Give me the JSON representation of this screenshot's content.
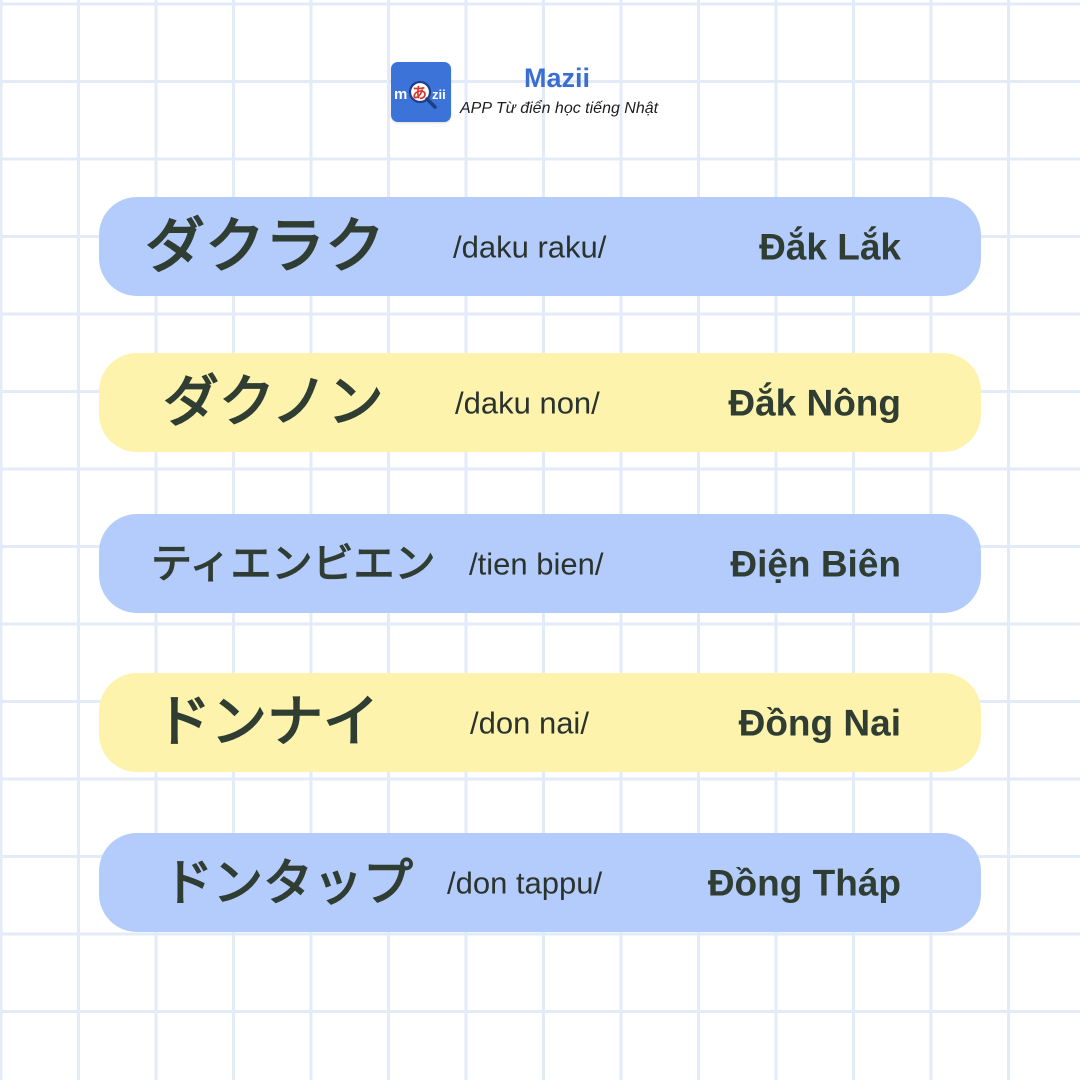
{
  "header": {
    "logo_text": "mあzii",
    "brand_name": "Mazii",
    "tagline": "APP Từ điển học tiếng Nhật"
  },
  "colors": {
    "blue_row": "#b4ccfb",
    "yellow_row": "#fdf3ad",
    "text": "#2f3d33",
    "brand": "#3a6fd1"
  },
  "rows": [
    {
      "kana": "ダクラク",
      "romaji": "/daku raku/",
      "vietnamese": "Đắk Lắk"
    },
    {
      "kana": "ダクノン",
      "romaji": "/daku non/",
      "vietnamese": "Đắk Nông"
    },
    {
      "kana": "ティエンビエン",
      "romaji": "/tien bien/",
      "vietnamese": "Điện Biên"
    },
    {
      "kana": "ドンナイ",
      "romaji": "/don nai/",
      "vietnamese": "Đồng Nai"
    },
    {
      "kana": "ドンタップ",
      "romaji": "/don tappu/",
      "vietnamese": "Đồng Tháp"
    }
  ]
}
